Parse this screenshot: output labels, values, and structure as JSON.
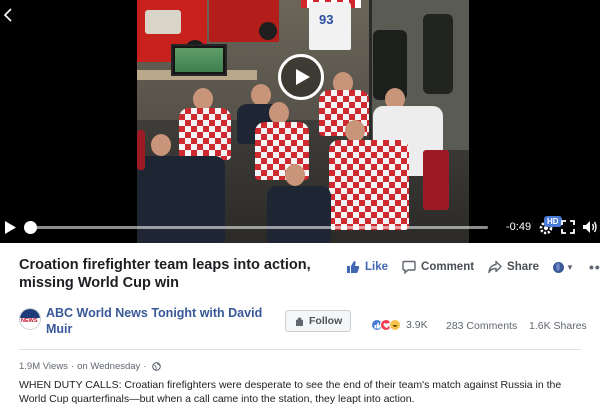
{
  "video": {
    "jersey_number": "93",
    "time_remaining": "-0:49",
    "quality_badge": "HD",
    "progress": 0.01
  },
  "post": {
    "title": "Croation firefighter team leaps into action, missing World Cup win",
    "actions": {
      "like_label": "Like",
      "comment_label": "Comment",
      "share_label": "Share"
    },
    "page": {
      "name": "ABC World News Tonight with David Muir",
      "avatar_text": "NEWS",
      "follow_label": "Follow"
    },
    "stats": {
      "reactions": "3.9K",
      "comments": "283 Comments",
      "shares": "1.6K Shares"
    },
    "views": "1.9M Views",
    "separator": "·",
    "posted": "on Wednesday",
    "description": "WHEN DUTY CALLS: Croatian firefighters were desperate to see the end of their team's match against Russia in the World Cup quarterfinals—but when a call came into the station, they leapt into action."
  },
  "colors": {
    "link_blue": "#385898",
    "like_blue": "#4267b2",
    "hd_badge": "#4a7bd6",
    "jersey_red": "#cf2a2f"
  },
  "icons": [
    "back-chevron-icon",
    "play-icon",
    "gear-icon",
    "fullscreen-icon",
    "volume-icon",
    "like-icon",
    "comment-icon",
    "share-icon",
    "globe-icon",
    "follow-icon",
    "more-icon"
  ]
}
